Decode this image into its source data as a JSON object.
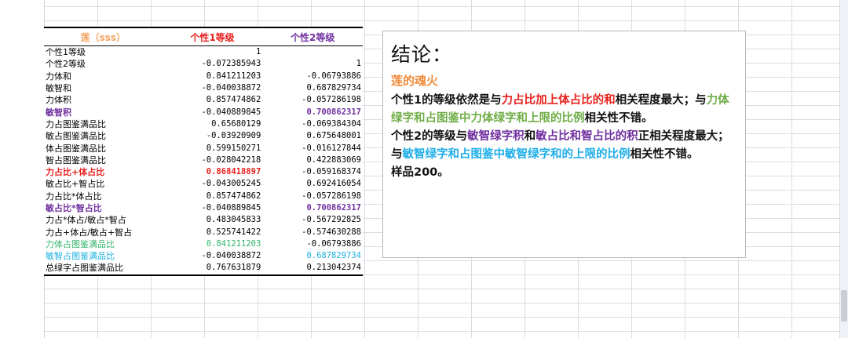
{
  "table": {
    "headers": {
      "title": "莲（sss）",
      "col1": "个性1等级",
      "col2": "个性2等级"
    },
    "rows": [
      {
        "label": "个性1等级",
        "v1": "1",
        "v2": ""
      },
      {
        "label": "个性2等级",
        "v1": "-0.072385943",
        "v2": "1"
      },
      {
        "label": "力体和",
        "v1": "0.841211203",
        "v2": "-0.06793886"
      },
      {
        "label": "敏智和",
        "v1": "-0.040038872",
        "v2": "0.687829734"
      },
      {
        "label": "力体积",
        "v1": "0.857474862",
        "v2": "-0.057286198"
      },
      {
        "label": "敏智积",
        "v1": "-0.040889845",
        "v2": "0.700862317"
      },
      {
        "label": "力占图鉴满品比",
        "v1": "0.65680129",
        "v2": "-0.069384304"
      },
      {
        "label": "敏占图鉴满品比",
        "v1": "-0.03920909",
        "v2": "0.675648001"
      },
      {
        "label": "体占图鉴满品比",
        "v1": "0.599150271",
        "v2": "-0.016127844"
      },
      {
        "label": "智占图鉴满品比",
        "v1": "-0.028042218",
        "v2": "0.422883069"
      },
      {
        "label": "力占比+体占比",
        "v1": "0.868418897",
        "v2": "-0.059168374"
      },
      {
        "label": "敏占比+智占比",
        "v1": "-0.043005245",
        "v2": "0.692416054"
      },
      {
        "label": "力占比*体占比",
        "v1": "0.857474862",
        "v2": "-0.057286198"
      },
      {
        "label": "敏占比*智占比",
        "v1": "-0.040889845",
        "v2": "0.700862317"
      },
      {
        "label": "力占*体占/敏占*智占",
        "v1": "0.483045833",
        "v2": "-0.567292825"
      },
      {
        "label": "力占+体占/敏占+智占",
        "v1": "0.525741422",
        "v2": "-0.574630288"
      },
      {
        "label": "力体占图鉴满品比",
        "v1": "0.841211203",
        "v2": "-0.06793886"
      },
      {
        "label": "敏智占图鉴满品比",
        "v1": "-0.040038872",
        "v2": "0.687829734"
      },
      {
        "label": "总绿字占图鉴满品比",
        "v1": "0.767631879",
        "v2": "0.213042374"
      }
    ]
  },
  "conclusion": {
    "title": "结论：",
    "subtitle": "莲的魂火",
    "p1": {
      "a": "个性1的等级依然是与",
      "b": "力占比加上体占比的和",
      "c": "相关程度最大；与",
      "d": "力体绿字和占图鉴中力体绿字和上限的比例",
      "e": "相关性不错。"
    },
    "p2": {
      "a": "个性2的等级与",
      "b": "敏智绿字积",
      "c": "和",
      "d": "敏占比和智占比的积",
      "e": "正相关程度最大；与",
      "f": "敏智绿字和占图鉴中敏智绿字和的上限的比例",
      "g": "相关性不错。"
    },
    "p3": "样品200。"
  },
  "colors": {
    "red": "#e8211d",
    "purple": "#7030a0",
    "green": "#70ad47",
    "cyan": "#1eaee8",
    "orange": "#f08c3c"
  }
}
